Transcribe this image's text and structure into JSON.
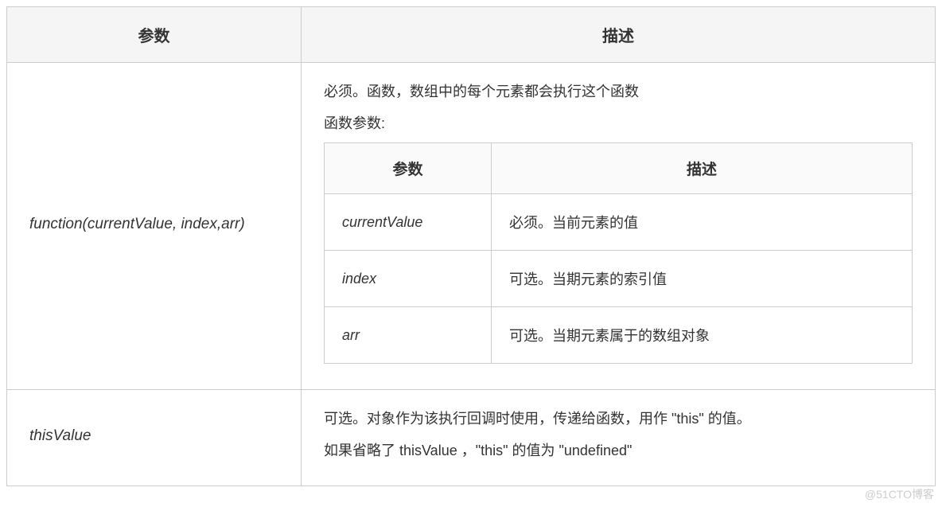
{
  "outer": {
    "headers": {
      "param": "参数",
      "desc": "描述"
    },
    "rows": [
      {
        "param": "function(currentValue, index,arr)",
        "desc_lines": [
          "必须。函数，数组中的每个元素都会执行这个函数",
          "函数参数:"
        ],
        "inner": {
          "headers": {
            "param": "参数",
            "desc": "描述"
          },
          "rows": [
            {
              "param": "currentValue",
              "desc": "必须。当前元素的值"
            },
            {
              "param": "index",
              "desc": "可选。当期元素的索引值"
            },
            {
              "param": "arr",
              "desc": "可选。当期元素属于的数组对象"
            }
          ]
        }
      },
      {
        "param": "thisValue",
        "desc_lines": [
          "可选。对象作为该执行回调时使用，传递给函数，用作 \"this\" 的值。",
          "如果省略了 thisValue ，\"this\" 的值为 \"undefined\""
        ]
      }
    ]
  },
  "watermark": "@51CTO博客"
}
